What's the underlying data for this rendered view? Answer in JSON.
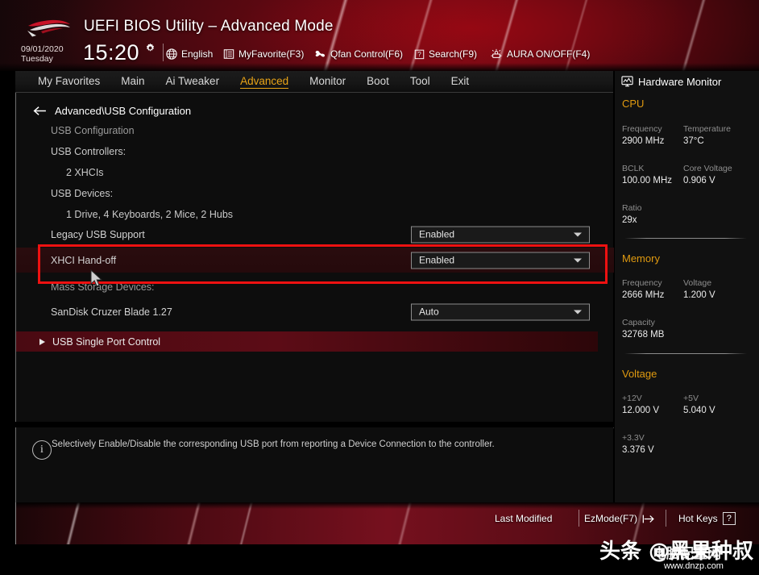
{
  "header": {
    "logo_icon": "rog-logo-icon",
    "title": "UEFI BIOS Utility – Advanced Mode",
    "date": "09/01/2020",
    "weekday": "Tuesday",
    "time": "15:20",
    "gear_icon": "gear-icon",
    "tools": [
      {
        "label": "English",
        "icon": "globe-icon"
      },
      {
        "label": "MyFavorite(F3)",
        "icon": "note-icon"
      },
      {
        "label": "Qfan Control(F6)",
        "icon": "fan-icon"
      },
      {
        "label": "Search(F9)",
        "icon": "question-box-icon"
      },
      {
        "label": "AURA ON/OFF(F4)",
        "icon": "aura-lamp-icon"
      }
    ]
  },
  "tabs": [
    {
      "label": "My Favorites",
      "active": false
    },
    {
      "label": "Main",
      "active": false
    },
    {
      "label": "Ai Tweaker",
      "active": false
    },
    {
      "label": "Advanced",
      "active": true
    },
    {
      "label": "Monitor",
      "active": false
    },
    {
      "label": "Boot",
      "active": false
    },
    {
      "label": "Tool",
      "active": false
    },
    {
      "label": "Exit",
      "active": false
    }
  ],
  "main": {
    "back_icon": "back-arrow-icon",
    "breadcrumb": "Advanced\\USB Configuration",
    "info_lines": [
      "USB Configuration",
      "USB Controllers:",
      "2 XHCIs",
      "USB Devices:",
      "1 Drive, 4 Keyboards, 2 Mice, 2 Hubs"
    ],
    "settings": [
      {
        "label": "Legacy USB Support",
        "value": "Enabled",
        "highlighted": false
      },
      {
        "label": "XHCI Hand-off",
        "value": "Enabled",
        "highlighted": true
      }
    ],
    "mass_storage_heading": "Mass Storage Devices:",
    "mass_storage": [
      {
        "label": "SanDisk Cruzer Blade 1.27",
        "value": "Auto"
      }
    ],
    "submenu": {
      "label": "USB Single Port Control",
      "arrow_icon": "right-arrow-icon"
    },
    "highlight_color": "#ee1111"
  },
  "help": {
    "icon": "info-icon",
    "text": "Selectively Enable/Disable the corresponding USB port from reporting a Device Connection to the controller."
  },
  "sidebar": {
    "title": "Hardware Monitor",
    "title_icon": "monitor-icon",
    "accent_color": "#e09a10",
    "groups": [
      {
        "name": "CPU",
        "rows": [
          [
            {
              "key": "Frequency",
              "value": "2900 MHz"
            },
            {
              "key": "Temperature",
              "value": "37°C"
            }
          ],
          [
            {
              "key": "BCLK",
              "value": "100.00 MHz"
            },
            {
              "key": "Core Voltage",
              "value": "0.906 V"
            }
          ],
          [
            {
              "key": "Ratio",
              "value": "29x"
            }
          ]
        ]
      },
      {
        "name": "Memory",
        "rows": [
          [
            {
              "key": "Frequency",
              "value": "2666 MHz"
            },
            {
              "key": "Voltage",
              "value": "1.200 V"
            }
          ],
          [
            {
              "key": "Capacity",
              "value": "32768 MB"
            }
          ]
        ]
      },
      {
        "name": "Voltage",
        "rows": [
          [
            {
              "key": "+12V",
              "value": "12.000 V"
            },
            {
              "key": "+5V",
              "value": "5.040 V"
            }
          ],
          [
            {
              "key": "+3.3V",
              "value": "3.376 V"
            }
          ]
        ]
      }
    ]
  },
  "footer": {
    "last_modified": "Last Modified",
    "ezmode": "EzMode(F7)",
    "ezmode_icon": "enter-arrow-icon",
    "hotkeys": "Hot Keys",
    "hotkeys_key": "?"
  },
  "watermark": {
    "main": "头条 @黑果种叔",
    "overlay": "电脑配置网",
    "url": "www.dnzp.com"
  }
}
